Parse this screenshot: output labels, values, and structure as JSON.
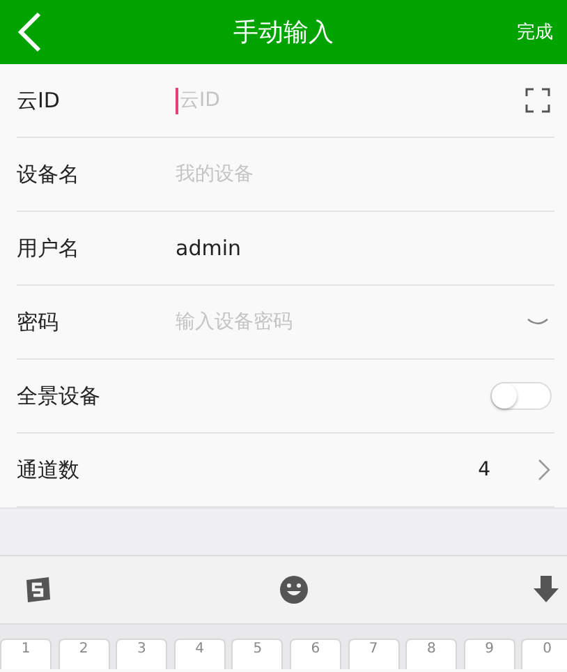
{
  "header": {
    "title": "手动输入",
    "action": "完成"
  },
  "fields": [
    {
      "kind": "text",
      "label": "云ID",
      "placeholder": "云ID",
      "focused": true,
      "scan": true
    },
    {
      "kind": "text",
      "label": "设备名",
      "placeholder": "我的设备",
      "focused": false,
      "scan": false
    },
    {
      "kind": "text",
      "label": "用户名",
      "value": "admin",
      "focused": false,
      "scan": false
    },
    {
      "kind": "password",
      "label": "密码",
      "placeholder": "输入设备密码",
      "focused": false
    },
    {
      "kind": "toggle",
      "label": "全景设备",
      "on": false
    },
    {
      "kind": "select",
      "label": "通道数",
      "value": "4"
    }
  ],
  "keyboard": {
    "keys": [
      {
        "digit": "1"
      },
      {
        "digit": "2"
      },
      {
        "digit": "3"
      },
      {
        "digit": "4"
      },
      {
        "digit": "5"
      },
      {
        "digit": "6"
      },
      {
        "digit": "7"
      },
      {
        "digit": "8"
      },
      {
        "digit": "9"
      },
      {
        "digit": "0"
      }
    ]
  }
}
